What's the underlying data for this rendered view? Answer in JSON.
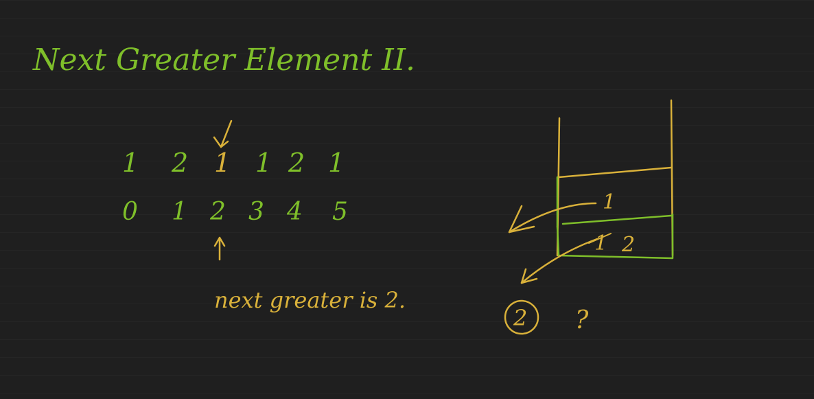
{
  "title": "Next Greater Element II.",
  "array": {
    "values": [
      "1",
      "2",
      "1",
      "1",
      "2",
      "1"
    ],
    "indices": [
      "0",
      "1",
      "2",
      "3",
      "4",
      "5"
    ]
  },
  "note": "next greater is 2.",
  "stack": {
    "top_value": "1",
    "bottom_values": [
      "1",
      "2"
    ]
  },
  "result": {
    "answer": "2",
    "query": "?"
  },
  "colors": {
    "background": "#1f1f1f",
    "green": "#7fbf2a",
    "yellow": "#d9b13a"
  }
}
